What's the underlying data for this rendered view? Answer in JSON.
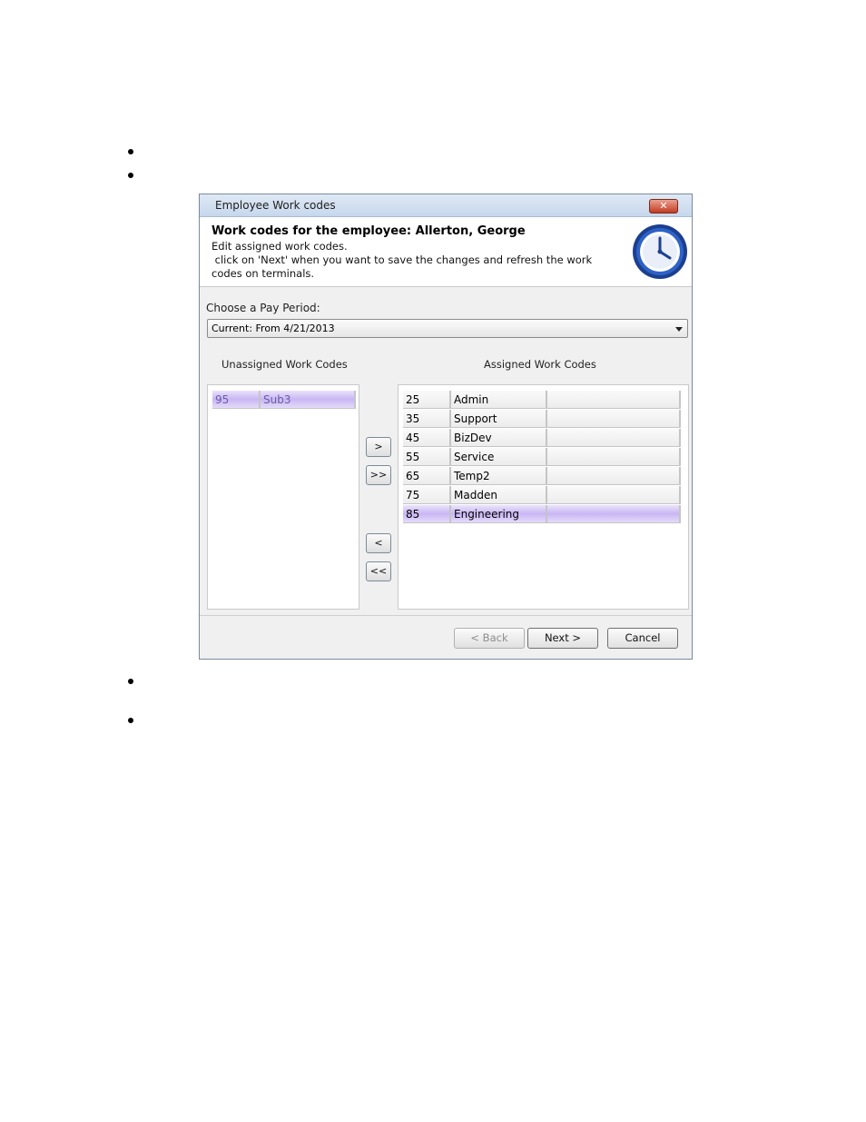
{
  "window": {
    "title": "Employee Work codes",
    "close_label": "✕"
  },
  "header": {
    "title": "Work codes for the employee: Allerton, George",
    "line1": "Edit assigned work codes.",
    "line2": " click on 'Next' when you want to save the changes and refresh the work",
    "line3": "codes on terminals.",
    "icon": "clock-icon"
  },
  "pay_period": {
    "label": "Choose a Pay Period:",
    "selected": "Current:  From 4/21/2013"
  },
  "unassigned": {
    "label": "Unassigned Work Codes",
    "rows": [
      {
        "code": "95",
        "name": "Sub3"
      }
    ]
  },
  "assigned": {
    "label": "Assigned Work Codes",
    "rows": [
      {
        "code": "25",
        "name": "Admin"
      },
      {
        "code": "35",
        "name": "Support"
      },
      {
        "code": "45",
        "name": "BizDev"
      },
      {
        "code": "55",
        "name": "Service"
      },
      {
        "code": "65",
        "name": "Temp2"
      },
      {
        "code": "75",
        "name": "Madden"
      },
      {
        "code": "85",
        "name": "Engineering"
      }
    ]
  },
  "transfer_buttons": {
    "add_one": ">",
    "add_all": ">>",
    "remove_one": "<",
    "remove_all": "<<"
  },
  "footer": {
    "back_label": "< Back",
    "next_label": "Next >",
    "cancel_label": "Cancel"
  }
}
